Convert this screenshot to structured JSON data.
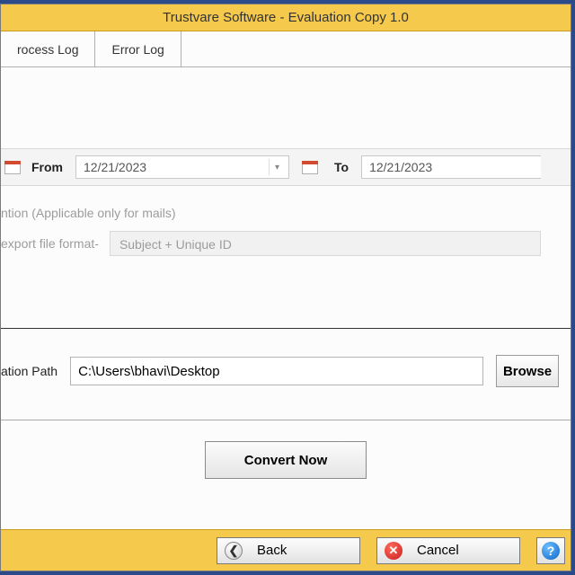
{
  "title": "Trustvare Software - Evaluation Copy 1.0",
  "tabs": {
    "process_log": "rocess Log",
    "error_log": "Error Log"
  },
  "date_filter": {
    "from_label": "From",
    "from_value": "12/21/2023",
    "to_label": "To",
    "to_value": "12/21/2023"
  },
  "naming": {
    "legend": "ntion (Applicable only for mails)",
    "label": "export file format-",
    "value": "Subject + Unique ID"
  },
  "destination": {
    "label": "ation Path",
    "value": "C:\\Users\\bhavi\\Desktop",
    "browse": "Browse"
  },
  "convert_label": "Convert Now",
  "footer": {
    "back": "Back",
    "cancel": "Cancel",
    "help": "?"
  }
}
